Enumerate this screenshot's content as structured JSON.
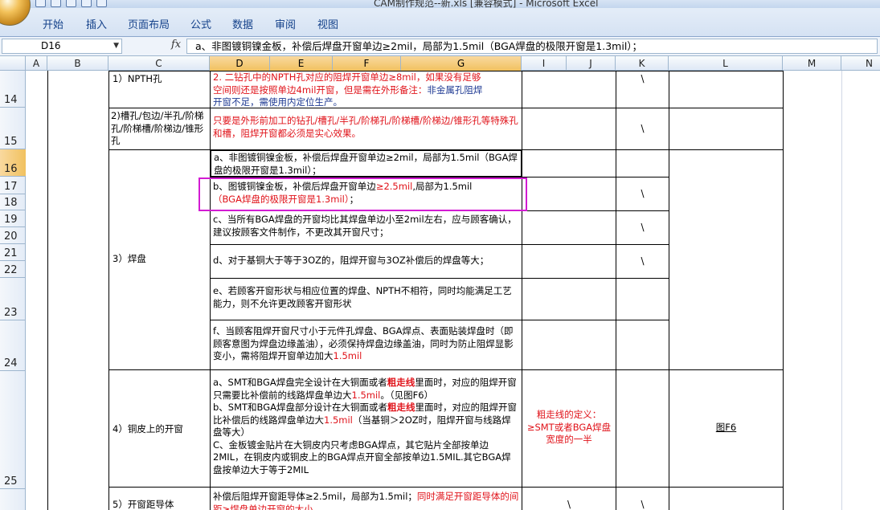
{
  "window": {
    "title": "CAM制作规范--新.xls [兼容模式] - Microsoft Excel"
  },
  "ribbon": {
    "tabs": [
      "开始",
      "插入",
      "页面布局",
      "公式",
      "数据",
      "审阅",
      "视图"
    ]
  },
  "formula_bar": {
    "name_box": "D16",
    "fx": "fx",
    "content": "a、非图镀铜镍金板，补偿后焊盘开窗单边≥2mil，局部为1.5mil（BGA焊盘的极限开窗是1.3mil）；"
  },
  "columns": [
    "A",
    "B",
    "C",
    "D",
    "E",
    "F",
    "G",
    "I",
    "J",
    "K",
    "L",
    "M",
    "N"
  ],
  "rows": [
    "14",
    "15",
    "16",
    "17",
    "18",
    "19",
    "20",
    "21",
    "22",
    "23",
    "24",
    "25"
  ],
  "cells": {
    "c14": "1）NPTH孔",
    "d14_a": "2. 二钻孔中的NPTH孔对应的阻焊开窗单边≥8mil，如果没有足够",
    "d14_b": "空间则还是按照单边4mil开窗，但是需在外形备注：",
    "d14_c": "非金属孔阻焊",
    "d14_d": "开窗不足，需使用内定位生产。",
    "k14": "\\",
    "c15": "2)槽孔/包边/半孔/阶梯孔/阶梯槽/阶梯边/锥形孔",
    "d15": "只要是外形前加工的钻孔/槽孔/半孔/阶梯孔/阶梯槽/阶梯边/锥形孔等特殊孔和槽，阻焊开窗都必须是实心效果。",
    "k15": "\\",
    "c_pad": "3）焊盘",
    "d16": "a、非图镀铜镍金板，补偿后焊盘开窗单边≥2mil，局部为1.5mil（BGA焊盘的极限开窗是1.3mil）；",
    "d17_a": "b、图镀铜镍金板，补偿后焊盘开窗单边",
    "d17_b": "≥2.5mil",
    "d17_c": ",局部为1.5mil",
    "d17_d": "（BGA焊盘的极限开窗是1.3mil）",
    "d17_e": "；",
    "k17": "\\",
    "d19": "c、当所有BGA焊盘的开窗均比其焊盘单边小至2mil左右，应与顾客确认，建议按顾客文件制作，不更改其开窗尺寸；",
    "k19": "\\",
    "d21": "d、对于基铜大于等于3OZ的，阻焊开窗与3OZ补偿后的焊盘等大；",
    "k21": "\\",
    "d23": "e、若顾客开窗形状与相应位置的焊盘、NPTH不相符，同时均能满足工艺能力，则不允许更改顾客开窗形状",
    "d24_a": "f、当顾客阻焊开窗尺寸小于元件孔焊盘、BGA焊点、表面贴装焊盘时（即顾客意图为焊盘边缘盖油），必须保持焊盘边缘盖油，同时为防止阻焊显影变小，需将阻焊开窗单边加大",
    "d24_b": "1.5mil",
    "c25": "4）铜皮上的开窗",
    "d25_1a": "a、SMT和BGA焊盘完全设计在大铜面或者",
    "d25_1b": "粗走线",
    "d25_1c": "里面时，对应的阻焊开窗只需要比补偿前的线路焊盘单边大",
    "d25_1d": "1.5mil",
    "d25_1e": "。（见图F6）",
    "d25_2a": "b、SMT和BGA焊盘部分设计在大铜面或者",
    "d25_2b": "粗走线",
    "d25_2c": "里面时，对应的阻焊开窗比补偿后的线路焊盘单边大",
    "d25_2d": "1.5mil",
    "d25_2e": "（当基铜＞2OZ时，阻焊开窗与线路焊盘等大）",
    "d25_3": "C、金板镀金贴片在大铜皮内只考虑BGA焊点，其它贴片全部按单边2MIL，在铜皮内或铜皮上的BGA焊点开窗全部按单边1.5MIL.其它BGA焊盘按单边大于等于2MIL",
    "i25": "粗走线的定义：≥SMT或者BGA焊盘宽度的一半",
    "l25": "图F6",
    "c26": "5）开窗距导体",
    "d26_a": "补偿后阻焊开窗距导体≥2.5mil，局部为1.5mil；",
    "d26_b": "同时满足开窗距导体的间距≥焊盘单边开窗的大小",
    "i26": "\\",
    "k26": "\\"
  },
  "colors": {
    "highlight": "#d21bd2",
    "red_text": "#e0131a",
    "blue_text": "#1f3a93",
    "selected_header": "#f1c15f"
  }
}
